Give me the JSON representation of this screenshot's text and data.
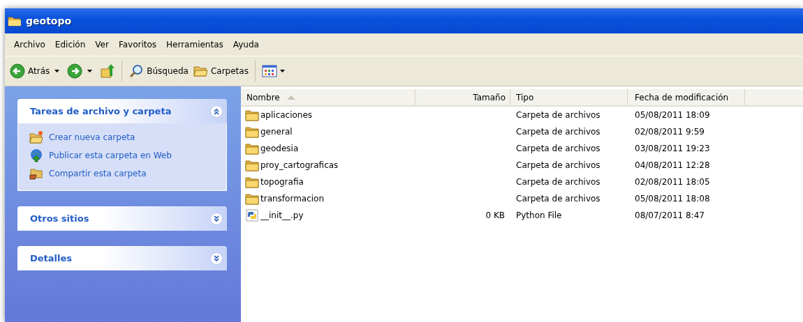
{
  "window": {
    "title": "geotopo"
  },
  "menu": [
    "Archivo",
    "Edición",
    "Ver",
    "Favoritos",
    "Herramientas",
    "Ayuda"
  ],
  "toolbar": {
    "back": "Atrás",
    "search": "Búsqueda",
    "folders": "Carpetas"
  },
  "panels": [
    {
      "title": "Tareas de archivo y carpeta",
      "expanded": true,
      "tasks": [
        {
          "kind": "new-folder",
          "label": "Crear nueva carpeta"
        },
        {
          "kind": "publish",
          "label": "Publicar esta carpeta en Web"
        },
        {
          "kind": "share",
          "label": "Compartir esta carpeta"
        }
      ]
    },
    {
      "title": "Otros sitios",
      "expanded": false
    },
    {
      "title": "Detalles",
      "expanded": false
    }
  ],
  "table": {
    "columns": [
      "Nombre",
      "Tamaño",
      "Tipo",
      "Fecha de modificación"
    ],
    "rows": [
      {
        "kind": "folder",
        "name": "aplicaciones",
        "type": "Carpeta de archivos",
        "modified": "05/08/2011 18:09"
      },
      {
        "kind": "folder",
        "name": "general",
        "type": "Carpeta de archivos",
        "modified": "02/08/2011 9:59"
      },
      {
        "kind": "folder",
        "name": "geodesia",
        "type": "Carpeta de archivos",
        "modified": "03/08/2011 19:23"
      },
      {
        "kind": "folder",
        "name": "proy_cartograficas",
        "type": "Carpeta de archivos",
        "modified": "04/08/2011 12:28"
      },
      {
        "kind": "folder",
        "name": "topografia",
        "type": "Carpeta de archivos",
        "modified": "02/08/2011 18:05"
      },
      {
        "kind": "folder",
        "name": "transformacion",
        "type": "Carpeta de archivos",
        "modified": "05/08/2011 18:08"
      },
      {
        "kind": "python",
        "name": "__init__.py",
        "size": "0 KB",
        "type": "Python File",
        "modified": "08/07/2011 8:47"
      }
    ]
  }
}
